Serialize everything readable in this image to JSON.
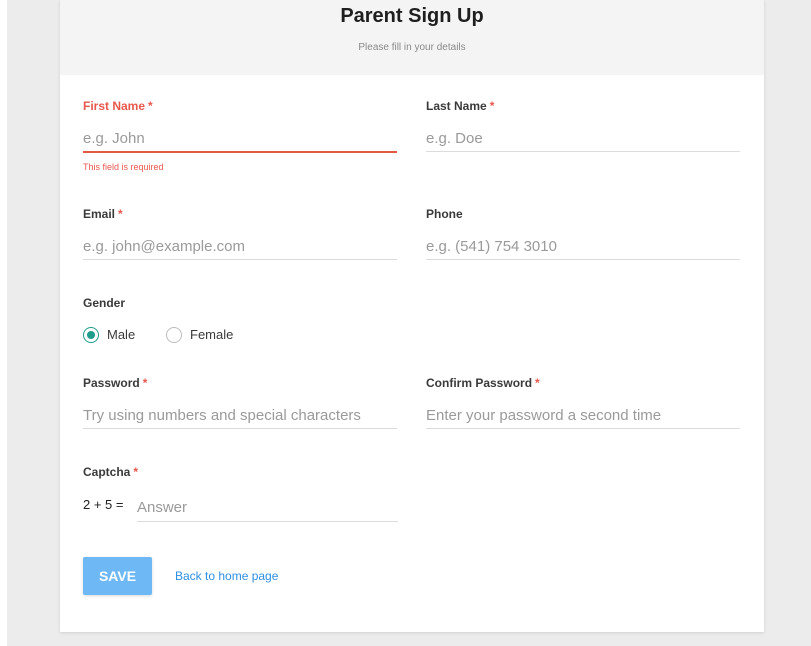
{
  "header": {
    "title": "Parent Sign Up",
    "subtitle": "Please fill in your details"
  },
  "form": {
    "first_name": {
      "label": "First Name",
      "required": "*",
      "placeholder": "e.g. John",
      "value": "",
      "error": "This field is required"
    },
    "last_name": {
      "label": "Last Name",
      "required": "*",
      "placeholder": "e.g. Doe",
      "value": ""
    },
    "email": {
      "label": "Email",
      "required": "*",
      "placeholder": "e.g. john@example.com",
      "value": ""
    },
    "phone": {
      "label": "Phone",
      "placeholder": "e.g. (541) 754 3010",
      "value": ""
    },
    "gender": {
      "label": "Gender",
      "options": [
        "Male",
        "Female"
      ],
      "selected": "Male"
    },
    "password": {
      "label": "Password",
      "required": "*",
      "placeholder": "Try using numbers and special characters",
      "value": ""
    },
    "confirm_password": {
      "label": "Confirm Password",
      "required": "*",
      "placeholder": "Enter your password a second time",
      "value": ""
    },
    "captcha": {
      "label": "Captcha",
      "required": "*",
      "question": "2 + 5 =",
      "placeholder": "Answer",
      "value": ""
    }
  },
  "actions": {
    "save_label": "SAVE",
    "back_link": "Back to home page"
  },
  "colors": {
    "accent": "#1e9d8b",
    "error": "#e8584d",
    "button": "#6eb8f5",
    "link": "#2f8fe0"
  }
}
